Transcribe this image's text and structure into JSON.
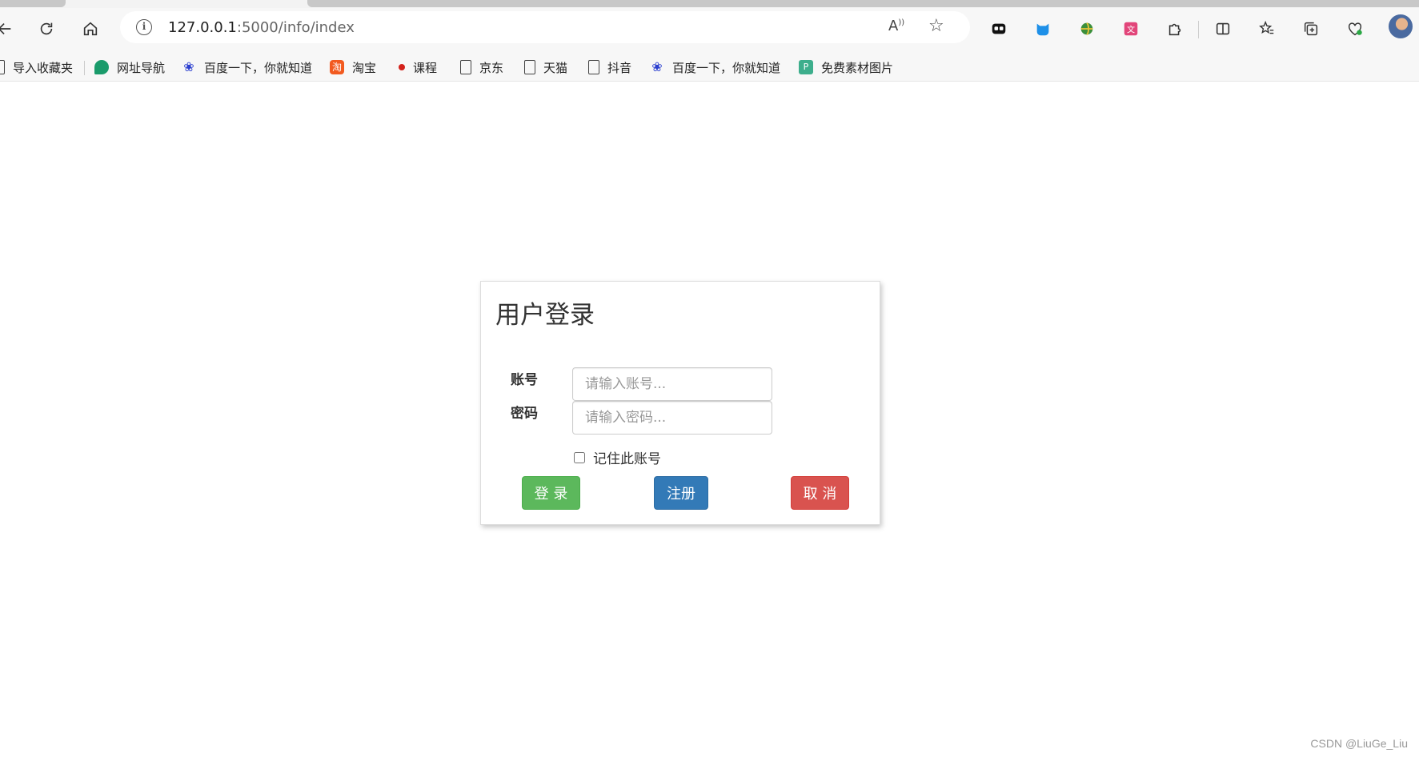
{
  "browser": {
    "url_host": "127.0.0.1",
    "url_path": ":5000/info/index",
    "bookmarks": [
      {
        "label": "导入收藏夹",
        "icon": "import-icon"
      },
      {
        "label": "网址导航",
        "icon": "leaf-icon"
      },
      {
        "label": "百度一下，你就知道",
        "icon": "baidu-paw-icon"
      },
      {
        "label": "淘宝",
        "icon": "taobao-icon"
      },
      {
        "label": "课程",
        "icon": "red-dot-icon"
      },
      {
        "label": "京东",
        "icon": "file-icon"
      },
      {
        "label": "天猫",
        "icon": "file-icon"
      },
      {
        "label": "抖音",
        "icon": "file-icon"
      },
      {
        "label": "百度一下，你就知道",
        "icon": "baidu-paw-icon"
      },
      {
        "label": "免费素材图片",
        "icon": "green-square-icon"
      }
    ]
  },
  "login": {
    "title": "用户登录",
    "account_label": "账号",
    "account_placeholder": "请输入账号...",
    "password_label": "密码",
    "password_placeholder": "请输入密码...",
    "remember_label": "记住此账号",
    "login_button": "登 录",
    "register_button": "注册",
    "cancel_button": "取 消"
  },
  "watermark": "CSDN @LiuGe_Liu",
  "colors": {
    "success": "#5cb85c",
    "primary": "#337ab7",
    "danger": "#d9534f"
  }
}
